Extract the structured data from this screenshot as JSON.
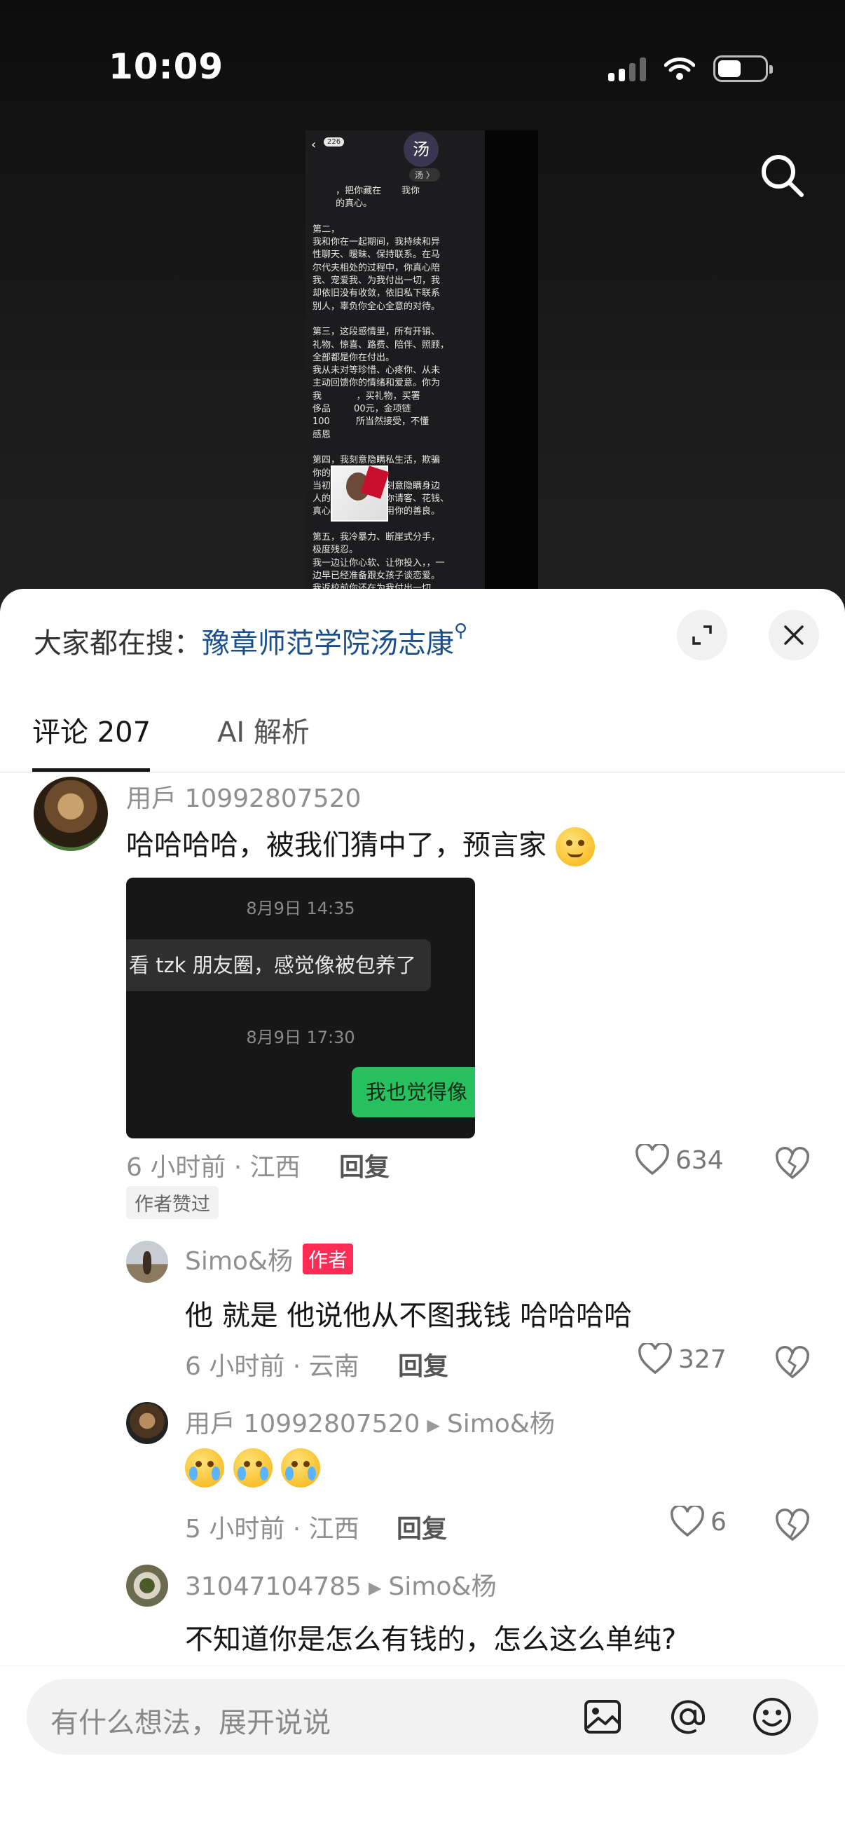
{
  "status_bar": {
    "time": "10:09"
  },
  "video": {
    "screenshot": {
      "badge": "226",
      "avatar_char": "汤",
      "avatar_label": "汤 〉",
      "body_text": "        ，把你藏在       我你\n        的真心。\n\n第二，\n我和你在一起期间，我持续和异\n性聊天、暧昧、保持联系。在马\n尔代夫相处的过程中，你真心陪\n我、宠爱我、为我付出一切，我\n却依旧没有收敛，依旧私下联系\n别人，辜负你全心全意的对待。\n\n第三，这段感情里，所有开销、\n礼物、惊喜、路费、陪伴、照顾，\n全部都是你在付出。\n我从未对等珍惜、心疼你、从未\n主动回馈你的情绪和爱意。你为\n我            ，买礼物，买署\n侈品        00元，金项链\n100         所当然接受，不懂\n感恩\n\n第四，我刻意隐瞒私生活，欺骗\n你的信任。\n当初深圳见面，我刻意隐瞒身边\n人的真实关系，让你请客、花钱、\n真心待人，我在利用你的善良。\n\n第五，我冷暴力、断崖式分手，\n极度残忍。\n我一边让你心软、让你投入，，一\n边早已经准备跟女孩子谈恋爱。\n我返校前你还在为我付出一切，\n我转头就剪头发、聊新的人、迅\n速开启新的关系，狠狠抛下你，\n让你一个人承受崩溃、难过、内\n耗和自我怀疑。"
    }
  },
  "sheet": {
    "hot_search_label": "大家都在搜：",
    "hot_search_keyword": "豫章师范学院汤志康",
    "tabs": [
      {
        "label": "评论 207",
        "active": true
      },
      {
        "label": "AI 解析",
        "active": false
      }
    ],
    "comments": [
      {
        "user": "用戶 10992807520",
        "text": "哈哈哈哈，被我们猜中了，预言家",
        "image": {
          "time1": "8月9日 14:35",
          "bubble_left": "看 tzk 朋友圈，感觉像被包养了",
          "time2": "8月9日 17:30",
          "bubble_right": "我也觉得像"
        },
        "meta": "6 小时前 · 江西",
        "reply": "回复",
        "likes": "634",
        "author_liked": "作者赞过"
      },
      {
        "user": "Simo&杨",
        "author_tag": "作者",
        "text": "他 就是 他说他从不图我钱 哈哈哈哈",
        "meta": "6 小时前 · 云南",
        "reply": "回复",
        "likes": "327"
      },
      {
        "user": "用戶 10992807520",
        "reply_to": "Simo&杨",
        "meta": "5 小时前 · 江西",
        "reply": "回复",
        "likes": "6"
      },
      {
        "user": "31047104785",
        "reply_to": "Simo&杨",
        "text": "不知道你是怎么有钱的，怎么这么单纯?"
      }
    ],
    "input_placeholder": "有什么想法，展开说说"
  },
  "colors": {
    "accent_red": "#fe2c55",
    "link_blue": "#1a4f8b",
    "wechat_green": "#27c25f"
  },
  "icons": [
    "search-icon",
    "expand-icon",
    "close-icon",
    "heart-icon",
    "broken-heart-icon",
    "image-icon",
    "at-icon",
    "emoji-icon"
  ]
}
